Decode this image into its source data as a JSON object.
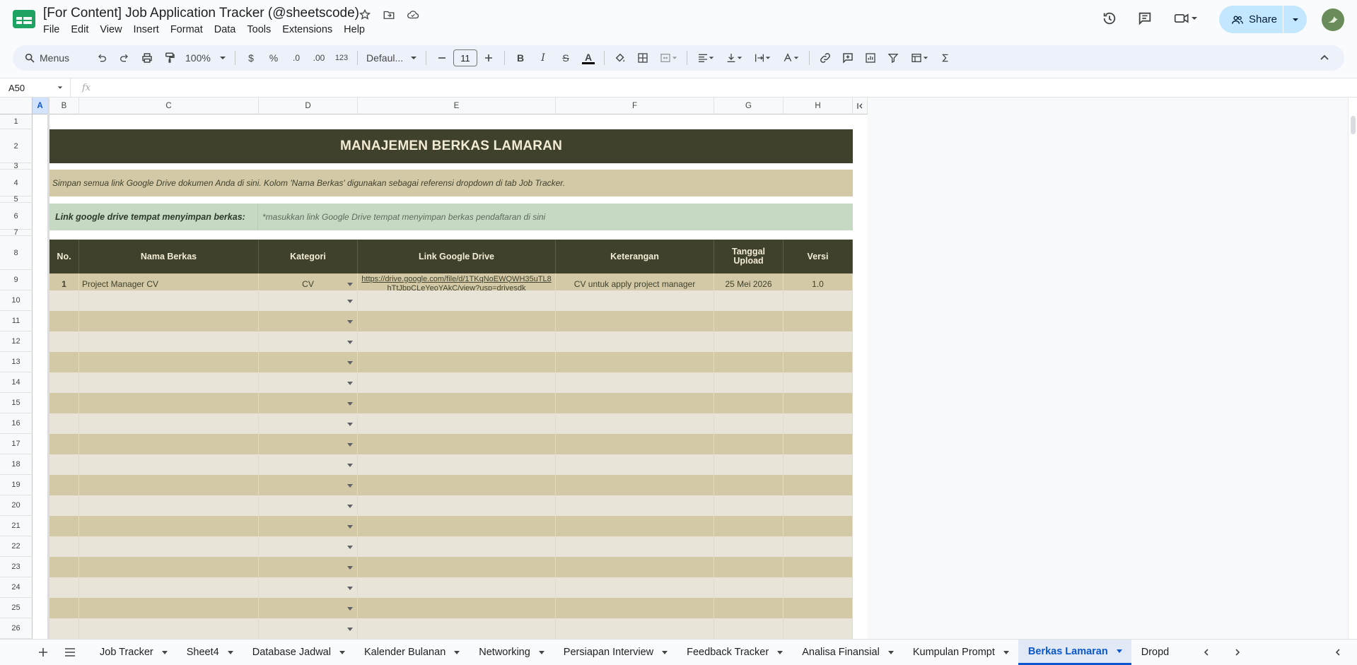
{
  "app": {
    "doc_title": "[For Content] Job Application Tracker (@sheetscode)",
    "menu": [
      "File",
      "Edit",
      "View",
      "Insert",
      "Format",
      "Data",
      "Tools",
      "Extensions",
      "Help"
    ],
    "share_label": "Share",
    "avatar_initial": ""
  },
  "toolbar": {
    "search_label": "Menus",
    "zoom": "100%",
    "currency": "$",
    "percent": "%",
    "dec_less": ".0",
    "dec_more": ".00",
    "number_format": "123",
    "font": "Defaul...",
    "font_size": "11",
    "bold": "B",
    "italic": "I",
    "strike": "S",
    "text_color_letter": "A"
  },
  "formula": {
    "cell_ref": "A50",
    "fx": "fx"
  },
  "columns": [
    "A",
    "B",
    "C",
    "D",
    "E",
    "F",
    "G",
    "H"
  ],
  "rows": [
    "1",
    "2",
    "3",
    "4",
    "5",
    "6",
    "7",
    "8",
    "9",
    "10",
    "11",
    "12",
    "13",
    "14",
    "15",
    "16",
    "17",
    "18",
    "19",
    "20",
    "21",
    "22",
    "23",
    "24",
    "25",
    "26"
  ],
  "sheet": {
    "title": "MANAJEMEN BERKAS LAMARAN",
    "description": "Simpan semua link Google Drive dokumen Anda di sini. Kolom 'Nama Berkas' digunakan sebagai referensi dropdown di tab Job Tracker.",
    "link_label": "Link google drive tempat menyimpan berkas:",
    "link_hint": "*masukkan link Google Drive tempat menyimpan berkas pendaftaran di sini",
    "headers": [
      "No.",
      "Nama Berkas",
      "Kategori",
      "Link Google Drive",
      "Keterangan",
      "Tanggal Upload",
      "Versi"
    ],
    "first_row": {
      "no": "1",
      "nama": "Project Manager CV",
      "kategori": "CV",
      "link": "https://drive.google.com/file/d/1TKqNoEWQWH35uTL8hTtJbpCLeYeoYAkC/view?usp=drivesdk",
      "keterangan": "CV untuk apply project manager",
      "tanggal": "25 Mei 2026",
      "versi": "1.0"
    }
  },
  "tabs": [
    "Job Tracker",
    "Sheet4",
    "Database Jadwal",
    "Kalender Bulanan",
    "Networking",
    "Persiapan Interview",
    "Feedback Tracker",
    "Analisa Finansial",
    "Kumpulan Prompt",
    "Berkas Lamaran",
    "Dropd"
  ],
  "active_tab": "Berkas Lamaran",
  "colors": {
    "header_dark": "#3f412c",
    "row_light": "#e8e4d8",
    "row_dark": "#d3c9a6",
    "link_band": "#c6d9c3",
    "accent": "#0b57d0"
  }
}
